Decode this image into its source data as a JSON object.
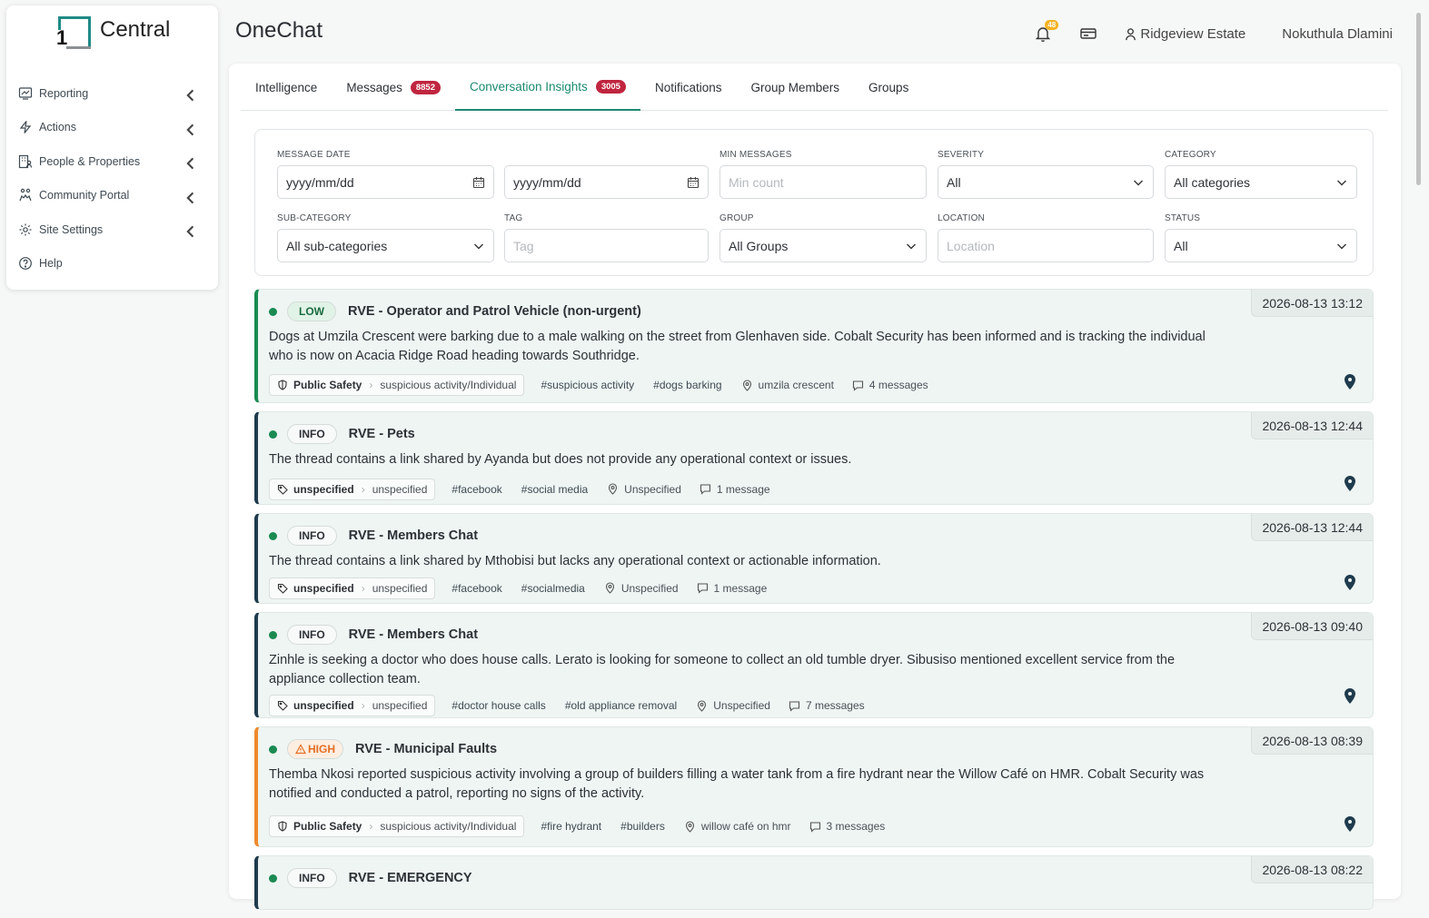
{
  "brand": {
    "logo_num": "1",
    "logo_text": "Central"
  },
  "sidebar": {
    "items": [
      {
        "label": "Reporting",
        "icon": "chart-icon"
      },
      {
        "label": "Actions",
        "icon": "bolt-icon"
      },
      {
        "label": "People & Properties",
        "icon": "people-icon"
      },
      {
        "label": "Community Portal",
        "icon": "portal-icon"
      },
      {
        "label": "Site Settings",
        "icon": "gear-icon"
      },
      {
        "label": "Help",
        "icon": "help-icon"
      }
    ]
  },
  "header": {
    "title": "OneChat",
    "notif_count": "48",
    "estate": "Ridgeview Estate",
    "user": "Nokuthula Dlamini"
  },
  "tabs": [
    {
      "label": "Intelligence",
      "badge": ""
    },
    {
      "label": "Messages",
      "badge": "8852"
    },
    {
      "label": "Conversation Insights",
      "badge": "3005"
    },
    {
      "label": "Notifications",
      "badge": ""
    },
    {
      "label": "Group Members",
      "badge": ""
    },
    {
      "label": "Groups",
      "badge": ""
    }
  ],
  "filters": {
    "message_date": {
      "label": "MESSAGE DATE",
      "from": "yyyy/mm/dd",
      "to": "yyyy/mm/dd"
    },
    "min_messages": {
      "label": "MIN MESSAGES",
      "placeholder": "Min count"
    },
    "severity": {
      "label": "SEVERITY",
      "value": "All"
    },
    "category": {
      "label": "CATEGORY",
      "value": "All categories"
    },
    "sub_category": {
      "label": "SUB-CATEGORY",
      "value": "All sub-categories"
    },
    "tag": {
      "label": "TAG",
      "placeholder": "Tag"
    },
    "group": {
      "label": "GROUP",
      "value": "All Groups"
    },
    "location": {
      "label": "LOCATION",
      "placeholder": "Location"
    },
    "status": {
      "label": "STATUS",
      "value": "All"
    }
  },
  "cards": [
    {
      "severity": "LOW",
      "title": "RVE - Operator and Patrol Vehicle (non-urgent)",
      "timestamp": "2026-08-13 13:12",
      "description": "Dogs at Umzila Crescent were barking due to a male walking on the street from Glenhaven side. Cobalt Security has been informed and is tracking the individual who is now on Acacia Ridge Road heading towards Southridge.",
      "category": "Public Safety",
      "category_icon": "shield-icon",
      "sub_category": "suspicious activity/Individual",
      "tags": [
        "#suspicious activity",
        "#dogs barking"
      ],
      "location": "umzila crescent",
      "messages": "4 messages"
    },
    {
      "severity": "INFO",
      "title": "RVE - Pets",
      "timestamp": "2026-08-13 12:44",
      "description": "The thread contains a link shared by Ayanda but does not provide any operational context or issues.",
      "category": "unspecified",
      "category_icon": "tag-icon",
      "sub_category": "unspecified",
      "tags": [
        "#facebook",
        "#social media"
      ],
      "location": "Unspecified",
      "messages": "1 message"
    },
    {
      "severity": "INFO",
      "title": "RVE - Members Chat",
      "timestamp": "2026-08-13 12:44",
      "description": "The thread contains a link shared by Mthobisi but lacks any operational context or actionable information.",
      "category": "unspecified",
      "category_icon": "tag-icon",
      "sub_category": "unspecified",
      "tags": [
        "#facebook",
        "#socialmedia"
      ],
      "location": "Unspecified",
      "messages": "1 message"
    },
    {
      "severity": "INFO",
      "title": "RVE - Members Chat",
      "timestamp": "2026-08-13 09:40",
      "description": "Zinhle is seeking a doctor who does house calls. Lerato is looking for someone to collect an old tumble dryer. Sibusiso mentioned excellent service from the appliance collection team.",
      "category": "unspecified",
      "category_icon": "tag-icon",
      "sub_category": "unspecified",
      "tags": [
        "#doctor house calls",
        "#old appliance removal"
      ],
      "location": "Unspecified",
      "messages": "7 messages"
    },
    {
      "severity": "HIGH",
      "title": "RVE - Municipal Faults",
      "timestamp": "2026-08-13 08:39",
      "description": "Themba Nkosi reported suspicious activity involving a group of builders filling a water tank from a fire hydrant near the Willow Café on HMR. Cobalt Security was notified and conducted a patrol, reporting no signs of the activity.",
      "category": "Public Safety",
      "category_icon": "shield-icon",
      "sub_category": "suspicious activity/Individual",
      "tags": [
        "#fire hydrant",
        "#builders"
      ],
      "location": "willow café on hmr",
      "messages": "3 messages"
    },
    {
      "severity": "INFO",
      "title": "RVE - EMERGENCY",
      "timestamp": "2026-08-13 08:22",
      "description": "",
      "category": "",
      "category_icon": "",
      "sub_category": "",
      "tags": [],
      "location": "",
      "messages": ""
    }
  ]
}
